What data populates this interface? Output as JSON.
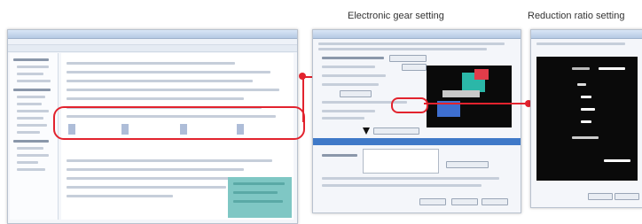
{
  "captions": {
    "electronic_gear": "Electronic gear setting",
    "reduction_ratio": "Reduction ratio setting"
  },
  "colors": {
    "highlight": "#e2232e",
    "window_title": "#b5c9e3"
  },
  "icons": {
    "arrow": "down-arrow-icon",
    "servo_model": "servo-motor-3d-icon"
  }
}
